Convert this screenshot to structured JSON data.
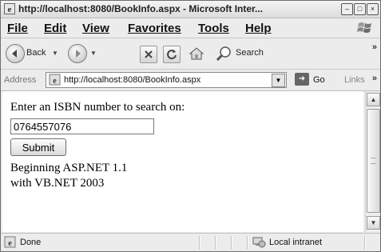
{
  "window": {
    "title": "http://localhost:8080/BookInfo.aspx - Microsoft Inter...",
    "minimize": "–",
    "maximize": "□",
    "close": "×"
  },
  "menu": [
    {
      "label": "File"
    },
    {
      "label": "Edit"
    },
    {
      "label": "View"
    },
    {
      "label": "Favorites"
    },
    {
      "label": "Tools"
    },
    {
      "label": "Help"
    }
  ],
  "toolbar": {
    "back_label": "Back",
    "search_label": "Search",
    "overflow": "»"
  },
  "address": {
    "label": "Address",
    "url": "http://localhost:8080/BookInfo.aspx",
    "go_label": "Go",
    "links_label": "Links",
    "links_overflow": "»"
  },
  "page": {
    "prompt": "Enter an ISBN number to search on:",
    "isbn_value": "0764557076",
    "submit_label": "Submit",
    "result_line1": "Beginning ASP.NET 1.1",
    "result_line2": "with VB.NET 2003"
  },
  "status": {
    "text": "Done",
    "zone": "Local intranet"
  }
}
